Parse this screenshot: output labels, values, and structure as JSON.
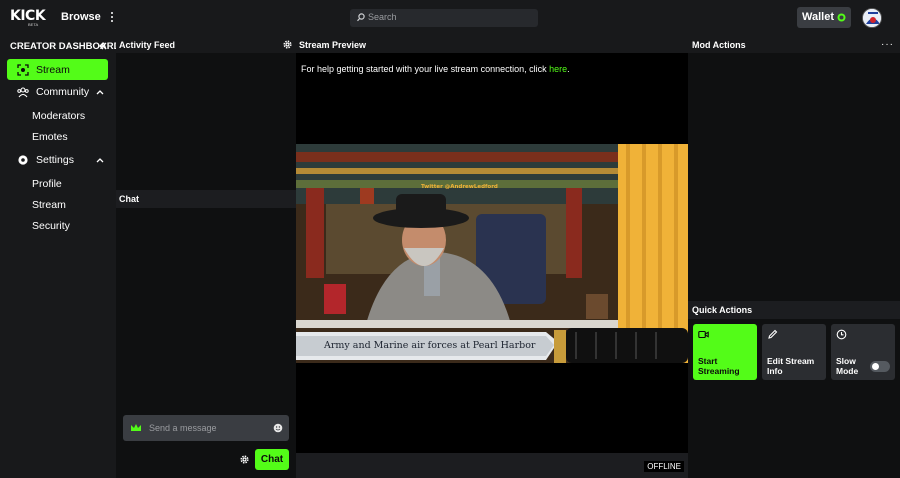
{
  "topbar": {
    "logo_text": "KICK",
    "logo_badge": "BETA",
    "browse_label": "Browse",
    "search_placeholder": "Search",
    "wallet_label": "Wallet"
  },
  "sidebar": {
    "title": "CREATOR DASHBOARD",
    "items": [
      {
        "label": "Stream",
        "icon": "stream-icon",
        "active": true
      },
      {
        "label": "Community",
        "icon": "community-icon",
        "expandable": true
      },
      {
        "label": "Moderators"
      },
      {
        "label": "Emotes"
      },
      {
        "label": "Settings",
        "icon": "settings-icon",
        "expandable": true
      },
      {
        "label": "Profile"
      },
      {
        "label": "Stream"
      },
      {
        "label": "Security"
      }
    ]
  },
  "activity_feed": {
    "title": "Activity Feed"
  },
  "chat": {
    "title": "Chat",
    "message_placeholder": "Send a message",
    "send_label": "Chat"
  },
  "preview": {
    "title": "Stream Preview",
    "help_text": "For help getting started with your live stream connection, click ",
    "help_link": "here",
    "help_suffix": ".",
    "overlay_twitter": "Twitter @AndrewLedford",
    "overlay_caption": "Army and Marine air forces at Pearl Harbor",
    "status": "OFFLINE"
  },
  "mod_actions": {
    "title": "Mod Actions",
    "more": "···"
  },
  "quick_actions": {
    "title": "Quick Actions",
    "buttons": [
      {
        "line1": "Start",
        "line2": "Streaming",
        "icon": "camera-icon"
      },
      {
        "line1": "Edit Stream",
        "line2": "Info",
        "icon": "pencil-icon"
      },
      {
        "line1": "Slow",
        "line2": "Mode",
        "icon": "clock-icon",
        "toggle_on": false
      }
    ]
  },
  "colors": {
    "accent": "#53fc18",
    "panel": "#18191b",
    "background": "#0f1011"
  }
}
